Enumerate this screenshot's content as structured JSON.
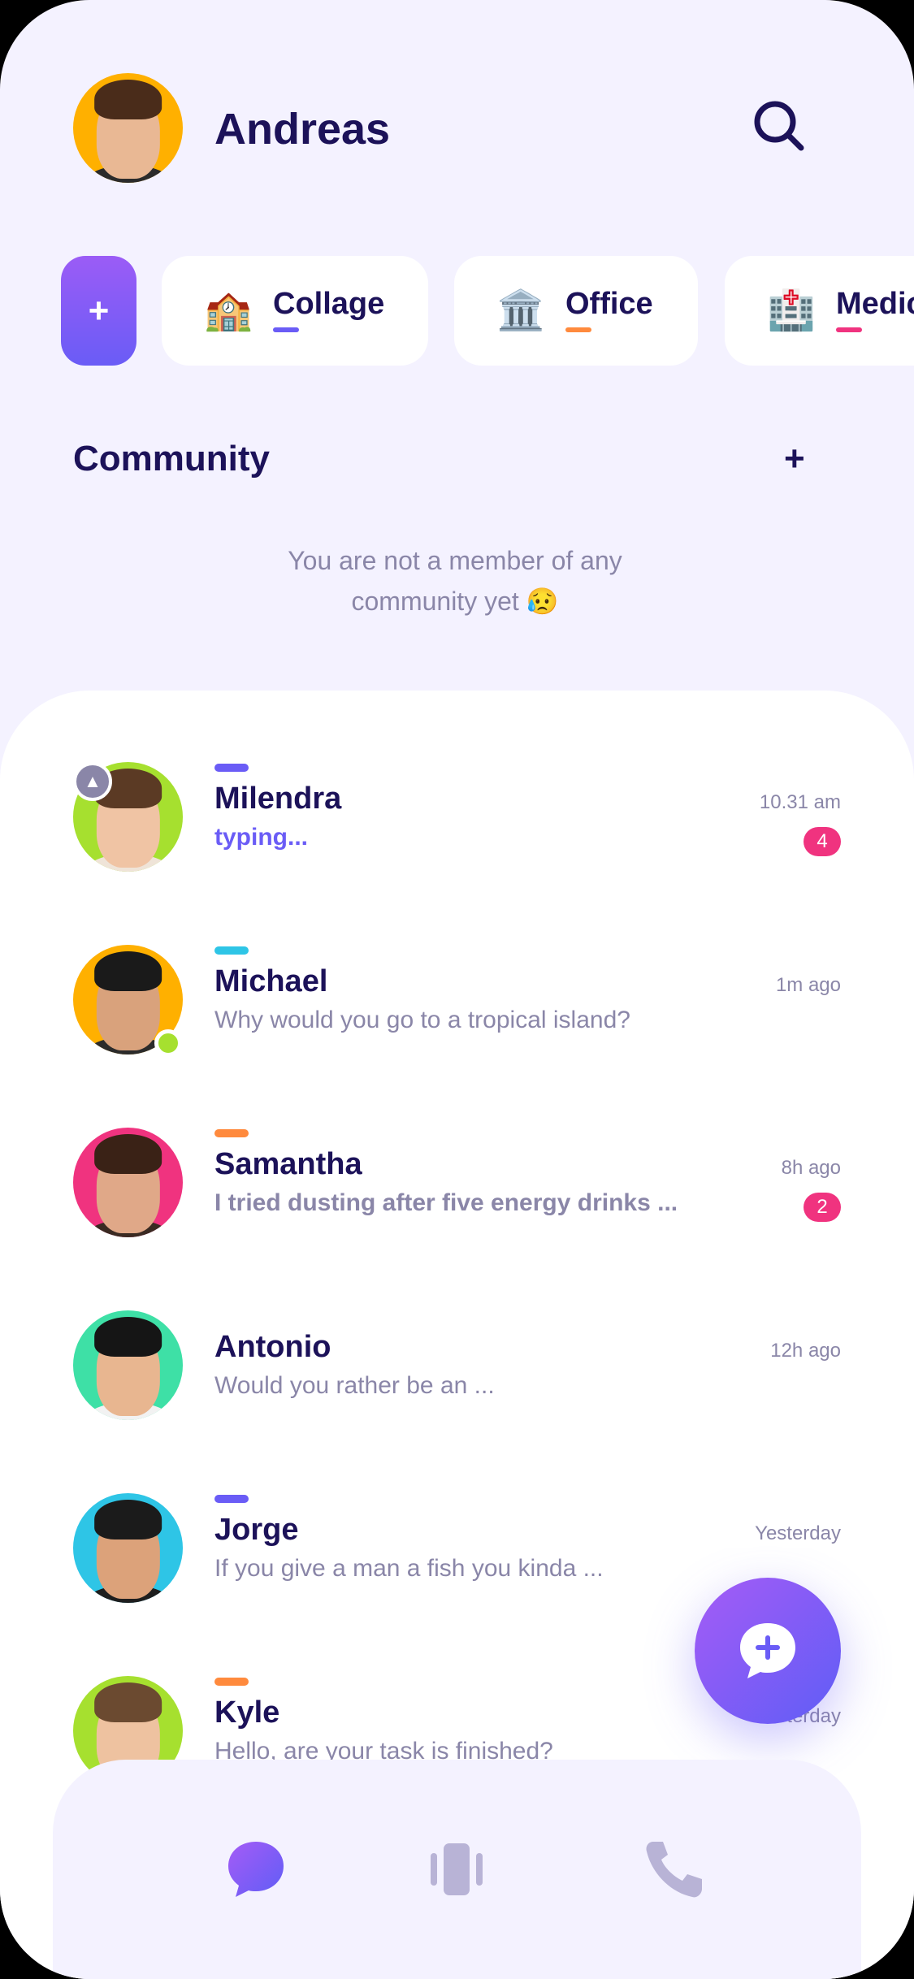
{
  "header": {
    "user_name": "Andreas",
    "search_icon": "search-icon"
  },
  "categories": {
    "add_label": "+",
    "items": [
      {
        "label": "Collage",
        "emoji": "🏫",
        "accent": "#6a5cf6"
      },
      {
        "label": "Office",
        "emoji": "🏛️",
        "accent": "#ff8a3d"
      },
      {
        "label": "Medic",
        "emoji": "🏥",
        "accent": "#f0337f"
      }
    ]
  },
  "community": {
    "title": "Community",
    "add_label": "+",
    "empty_message_line1": "You are not a member of any",
    "empty_message_line2": "community yet 😥"
  },
  "chats": [
    {
      "name": "Milendra",
      "message": "typing...",
      "time": "10.31 am",
      "badge": "4",
      "tag_color": "#6a5cf6",
      "pinned": true
    },
    {
      "name": "Michael",
      "message": "Why would you go to a tropical island?",
      "time": "1m ago",
      "badge": "",
      "tag_color": "#2ec5e6",
      "online": true
    },
    {
      "name": "Samantha",
      "message": "I tried dusting after five energy drinks ...",
      "time": "8h ago",
      "badge": "2",
      "tag_color": "#ff8a3d"
    },
    {
      "name": "Antonio",
      "message": "Would you rather be an ...",
      "time": "12h ago",
      "badge": ""
    },
    {
      "name": "Jorge",
      "message": "If you give a man a fish you kinda ...",
      "time": "Yesterday",
      "badge": "",
      "tag_color": "#6a5cf6"
    },
    {
      "name": "Kyle",
      "message": "Hello, are your task is finished?",
      "time": "Yesterday",
      "badge": "",
      "tag_color": "#ff8a3d"
    }
  ],
  "fab": {
    "icon": "new-chat-icon"
  },
  "tabbar": {
    "items": [
      "chat-icon",
      "stories-icon",
      "phone-icon"
    ]
  },
  "colors": {
    "primary": "#6a5cf6",
    "text_dark": "#1c1259",
    "text_muted": "#8a86a8",
    "badge": "#f0337f",
    "background": "#f4f2ff"
  }
}
